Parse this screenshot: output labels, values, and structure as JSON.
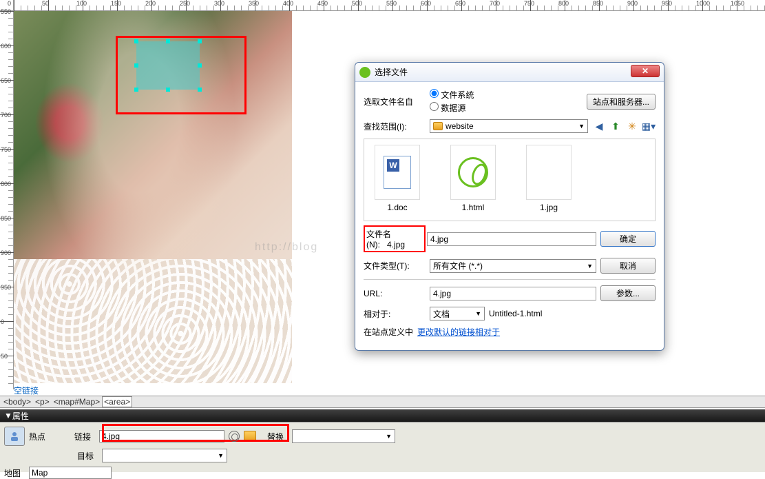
{
  "ruler_h": [
    "0",
    "50",
    "100",
    "150",
    "200",
    "250",
    "300",
    "350",
    "400",
    "450",
    "500",
    "550",
    "600",
    "650",
    "700",
    "750",
    "800",
    "850",
    "900",
    "950",
    "1000",
    "1050"
  ],
  "ruler_v": [
    "550",
    "600",
    "650",
    "700",
    "750",
    "800",
    "850",
    "900",
    "950",
    "0",
    "50"
  ],
  "canvas": {
    "empty_link": "空链接"
  },
  "tag_path": {
    "body": "<body>",
    "p": "<p>",
    "map": "<map#Map>",
    "area": "<area>"
  },
  "dialog": {
    "title": "选择文件",
    "source_label": "选取文件名自",
    "source_fs": "文件系统",
    "source_db": "数据源",
    "sites_btn": "站点和服务器...",
    "lookin_label": "查找范围(I):",
    "lookin_value": "website",
    "files": [
      {
        "name": "1.doc"
      },
      {
        "name": "1.html"
      },
      {
        "name": "1.jpg"
      }
    ],
    "filename_label": "文件名(N):",
    "filename_value": "4.jpg",
    "filetype_label": "文件类型(T):",
    "filetype_value": "所有文件 (*.*)",
    "ok_btn": "确定",
    "cancel_btn": "取消",
    "url_label": "URL:",
    "url_value": "4.jpg",
    "param_btn": "参数...",
    "relative_label": "相对于:",
    "relative_value": "文档",
    "relative_file": "Untitled-1.html",
    "site_note_prefix": "在站点定义中",
    "site_note_link": "更改默认的链接相对于"
  },
  "properties": {
    "panel_title": "属性",
    "hotspot_label": "热点",
    "link_label": "链接",
    "link_value": "4.jpg",
    "target_label": "目标",
    "alt_label": "替换",
    "map_label": "地图",
    "map_value": "Map"
  },
  "watermark": "http://blog"
}
